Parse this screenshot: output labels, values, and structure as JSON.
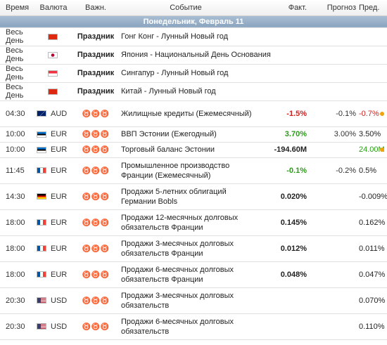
{
  "headers": {
    "time": "Время",
    "currency": "Валюта",
    "importance": "Важн.",
    "event": "Событие",
    "actual": "Факт.",
    "forecast": "Прогноз",
    "previous": "Пред."
  },
  "day_header": "Понедельник, Февраль 11",
  "colors": {
    "negative": "#d21f1f",
    "positive": "#2a9d17",
    "alert_dot": "#f0a30a"
  },
  "holidays": [
    {
      "time": "Весь День",
      "flag": "hong-kong-flag",
      "kind": "Праздник",
      "event": "Гонг Конг - Лунный Новый год"
    },
    {
      "time": "Весь День",
      "flag": "japan-flag",
      "kind": "Праздник",
      "event": "Япония - Национальный День Основания"
    },
    {
      "time": "Весь День",
      "flag": "singapore-flag",
      "kind": "Праздник",
      "event": "Сингапур - Лунный Новый год"
    },
    {
      "time": "Весь День",
      "flag": "china-flag",
      "kind": "Праздник",
      "event": "Китай - Лунный Новый год"
    }
  ],
  "events": [
    {
      "time": "04:30",
      "currency": "AUD",
      "flag": "australia-flag",
      "importance": 1,
      "event": "Жилищные кредиты (Ежемесячный)",
      "actual": "-1.5%",
      "actual_color": "red",
      "forecast": "-0.1%",
      "previous": "-0.7%",
      "previous_color": "red",
      "alert": true
    },
    {
      "time": "10:00",
      "currency": "EUR",
      "flag": "estonia-flag",
      "importance": 1,
      "event": "ВВП Эстонии (Ежегодный)",
      "actual": "3.70%",
      "actual_color": "green",
      "forecast": "3.00%",
      "previous": "3.50%",
      "previous_color": "black",
      "alert": false
    },
    {
      "time": "10:00",
      "currency": "EUR",
      "flag": "estonia-flag",
      "importance": 1,
      "event": "Торговый баланс Эстонии",
      "actual": "-194.60M",
      "actual_color": "black",
      "forecast": "",
      "previous": "24.00M",
      "previous_color": "green",
      "alert": true
    },
    {
      "time": "11:45",
      "currency": "EUR",
      "flag": "france-flag",
      "importance": 1,
      "event": "Промышленное производство Франции (Ежемесячный)",
      "actual": "-0.1%",
      "actual_color": "green",
      "forecast": "-0.2%",
      "previous": "0.5%",
      "previous_color": "black",
      "alert": false
    },
    {
      "time": "14:30",
      "currency": "EUR",
      "flag": "germany-flag",
      "importance": 1,
      "event": "Продажи 5-летних облигаций Германии Bobls",
      "actual": "0.020%",
      "actual_color": "black",
      "forecast": "",
      "previous": "-0.009%",
      "previous_color": "black",
      "alert": false
    },
    {
      "time": "18:00",
      "currency": "EUR",
      "flag": "france-flag",
      "importance": 1,
      "event": "Продажи 12-месячных долговых обязательств Франции",
      "actual": "0.145%",
      "actual_color": "black",
      "forecast": "",
      "previous": "0.162%",
      "previous_color": "black",
      "alert": false
    },
    {
      "time": "18:00",
      "currency": "EUR",
      "flag": "france-flag",
      "importance": 1,
      "event": "Продажи 3-месячных долговых обязательств Франции",
      "actual": "0.012%",
      "actual_color": "black",
      "forecast": "",
      "previous": "0.011%",
      "previous_color": "black",
      "alert": false
    },
    {
      "time": "18:00",
      "currency": "EUR",
      "flag": "france-flag",
      "importance": 1,
      "event": "Продажи 6-месячных долговых обязательств Франции",
      "actual": "0.048%",
      "actual_color": "black",
      "forecast": "",
      "previous": "0.047%",
      "previous_color": "black",
      "alert": false
    },
    {
      "time": "20:30",
      "currency": "USD",
      "flag": "usa-flag",
      "importance": 1,
      "event": "Продажи 3-месячных долговых обязательств",
      "actual": "",
      "actual_color": "black",
      "forecast": "",
      "previous": "0.070%",
      "previous_color": "black",
      "alert": false
    },
    {
      "time": "20:30",
      "currency": "USD",
      "flag": "usa-flag",
      "importance": 1,
      "event": "Продажи 6-месячных долговых обязательств",
      "actual": "",
      "actual_color": "black",
      "forecast": "",
      "previous": "0.110%",
      "previous_color": "black",
      "alert": false
    }
  ]
}
